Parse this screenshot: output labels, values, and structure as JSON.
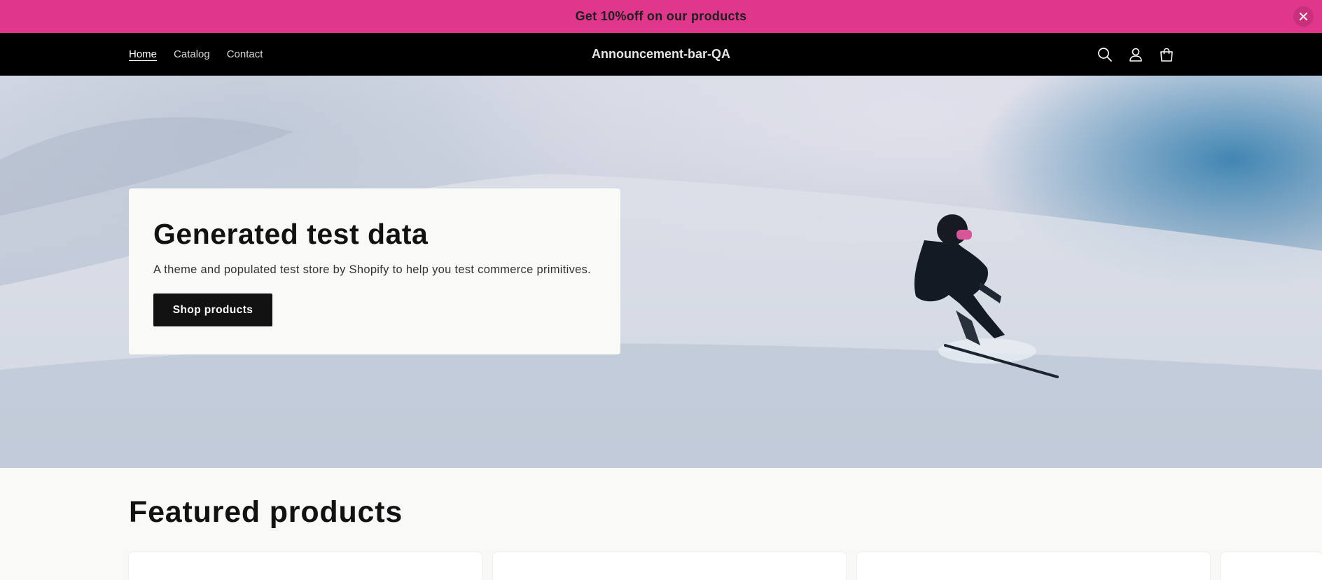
{
  "announcement": {
    "text": "Get 10%off on our products",
    "close_icon": "close-icon"
  },
  "header": {
    "brand": "Announcement-bar-QA",
    "nav": [
      {
        "label": "Home",
        "active": true
      },
      {
        "label": "Catalog",
        "active": false
      },
      {
        "label": "Contact",
        "active": false
      }
    ],
    "icons": [
      "search-icon",
      "account-icon",
      "cart-icon"
    ]
  },
  "hero": {
    "title": "Generated test data",
    "subtitle": "A theme and populated test store by Shopify to help you test commerce primitives.",
    "button_label": "Shop products"
  },
  "featured": {
    "title": "Featured products"
  },
  "colors": {
    "announcement_bg": "#e0378c",
    "header_bg": "#000000",
    "button_bg": "#121212",
    "page_bg": "#f9f9f7"
  }
}
